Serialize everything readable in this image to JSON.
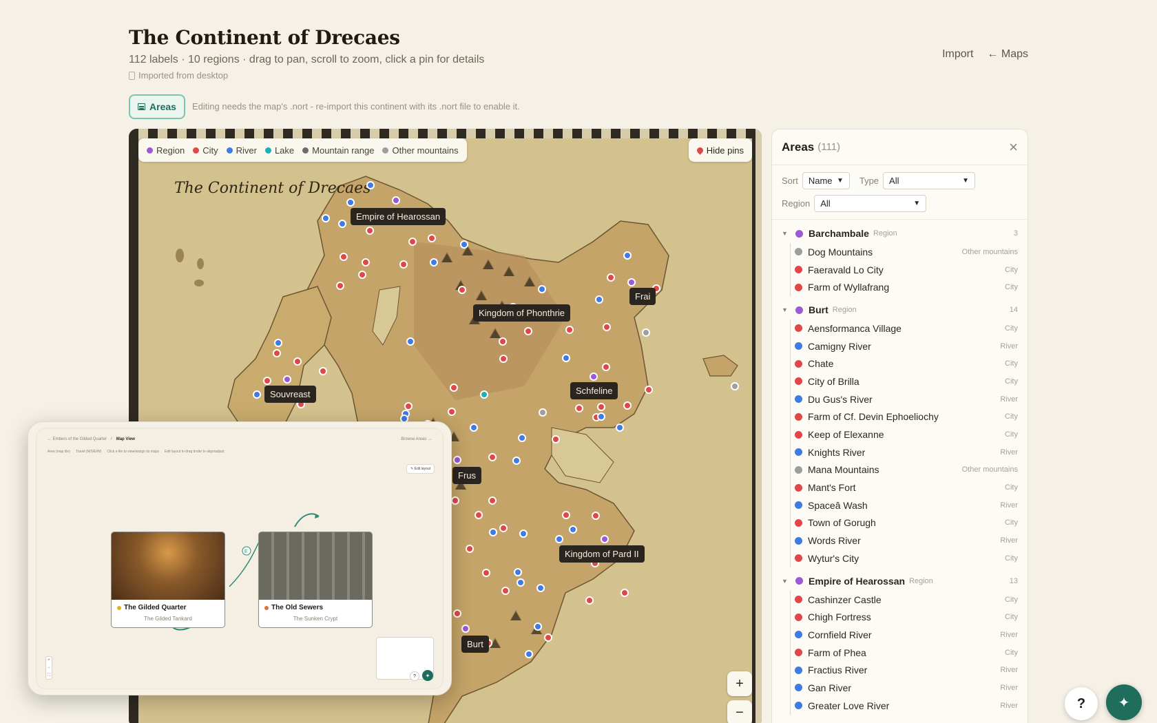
{
  "header": {
    "title": "The Continent of Drecaes",
    "subtitle": "112 labels · 10 regions · drag to pan, scroll to zoom, click a pin for details",
    "import_note": "Imported from desktop",
    "import_link": "Import",
    "maps_link": "← Maps"
  },
  "toolbar": {
    "areas_label": "Areas",
    "edit_note": "Editing needs the map's .nort - re-import this continent with its .nort file to enable it."
  },
  "map": {
    "title": "The Continent of Drecaes",
    "hide_pins_label": "Hide pins",
    "zoom_in": "+",
    "zoom_out": "−",
    "legend": [
      {
        "label": "Region",
        "color": "#9b59d6"
      },
      {
        "label": "City",
        "color": "#e04848"
      },
      {
        "label": "River",
        "color": "#3f7be0"
      },
      {
        "label": "Lake",
        "color": "#19b1b8"
      },
      {
        "label": "Mountain range",
        "color": "#6d6d6d"
      },
      {
        "label": "Other mountains",
        "color": "#9e9e9e"
      }
    ],
    "region_labels": [
      "Empire of Hearossan",
      "Frai",
      "Kingdom of Phonthrie",
      "Schfeline",
      "Souvreast",
      "Frus",
      "Kingdom of Pard II",
      "Burt"
    ]
  },
  "preview": {
    "crumb_parent": "← Embers of the Gilded Quarter",
    "crumb_current": "Map View",
    "browse": "Browse Areas →",
    "tools": [
      "Area (map tile)",
      "Travel (N/S/E/W)",
      "Click a tile to view/assign its maps",
      "Edit layout to drag tinder to align/adjust"
    ],
    "edit_layout": "✎ Edit layout",
    "connector_label": "E",
    "card1": {
      "name": "The Gilded Quarter",
      "sub": "The Gilded Tankard",
      "dot": "#e0b020"
    },
    "card2": {
      "name": "The Old Sewers",
      "sub": "The Sunken Crypt",
      "dot": "#e07030"
    },
    "help": "?",
    "ai": "✦",
    "zoom_plus": "+",
    "zoom_minus": "−",
    "zoom_fit": "⛶"
  },
  "sidebar": {
    "title": "Areas",
    "count": "(111)",
    "close": "×",
    "sort_label": "Sort",
    "sort_value": "Name",
    "type_label": "Type",
    "type_value": "All",
    "region_label": "Region",
    "region_value": "All",
    "groups": [
      {
        "name": "Barchambale",
        "type": "Region",
        "count": "3",
        "items": [
          {
            "name": "Dog Mountains",
            "type": "Other mountains",
            "color": "#9e9e9e"
          },
          {
            "name": "Faeravald Lo City",
            "type": "City",
            "color": "#e04848"
          },
          {
            "name": "Farm of Wyllafrang",
            "type": "City",
            "color": "#e04848"
          }
        ]
      },
      {
        "name": "Burt",
        "type": "Region",
        "count": "14",
        "items": [
          {
            "name": "Aensformanca Village",
            "type": "City",
            "color": "#e04848"
          },
          {
            "name": "Camigny River",
            "type": "River",
            "color": "#3f7be0"
          },
          {
            "name": "Chate",
            "type": "City",
            "color": "#e04848"
          },
          {
            "name": "City of Brilla",
            "type": "City",
            "color": "#e04848"
          },
          {
            "name": "Du Gus's River",
            "type": "River",
            "color": "#3f7be0"
          },
          {
            "name": "Farm of Cf. Devin Ephoeliochy",
            "type": "City",
            "color": "#e04848"
          },
          {
            "name": "Keep of Elexanne",
            "type": "City",
            "color": "#e04848"
          },
          {
            "name": "Knights River",
            "type": "River",
            "color": "#3f7be0"
          },
          {
            "name": "Mana Mountains",
            "type": "Other mountains",
            "color": "#9e9e9e"
          },
          {
            "name": "Mant's Fort",
            "type": "City",
            "color": "#e04848"
          },
          {
            "name": "Spaceâ Wash",
            "type": "River",
            "color": "#3f7be0"
          },
          {
            "name": "Town of Gorugh",
            "type": "City",
            "color": "#e04848"
          },
          {
            "name": "Words River",
            "type": "River",
            "color": "#3f7be0"
          },
          {
            "name": "Wytur's City",
            "type": "City",
            "color": "#e04848"
          }
        ]
      },
      {
        "name": "Empire of Hearossan",
        "type": "Region",
        "count": "13",
        "items": [
          {
            "name": "Cashinzer Castle",
            "type": "City",
            "color": "#e04848"
          },
          {
            "name": "Chigh Fortress",
            "type": "City",
            "color": "#e04848"
          },
          {
            "name": "Cornfield River",
            "type": "River",
            "color": "#3f7be0"
          },
          {
            "name": "Farm of Phea",
            "type": "City",
            "color": "#e04848"
          },
          {
            "name": "Fractius River",
            "type": "River",
            "color": "#3f7be0"
          },
          {
            "name": "Gan River",
            "type": "River",
            "color": "#3f7be0"
          },
          {
            "name": "Greater Love River",
            "type": "River",
            "color": "#3f7be0"
          }
        ]
      }
    ]
  },
  "floating": {
    "help": "?",
    "ai": "✦"
  }
}
